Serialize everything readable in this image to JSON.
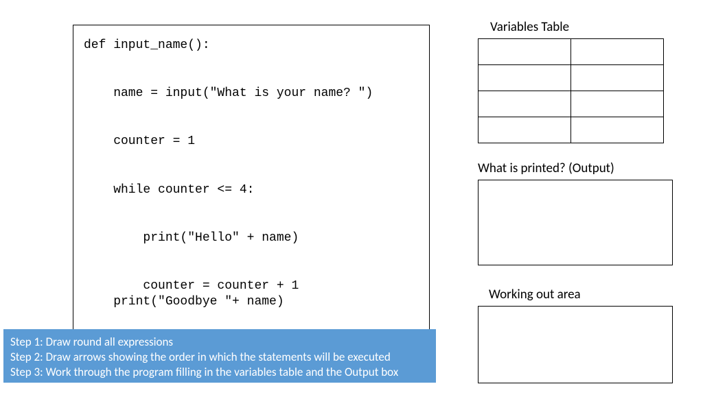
{
  "code": {
    "line1": "def input_name():",
    "line2": "",
    "line3": "    name = input(\"What is your name? \")",
    "line4": "",
    "line5": "    counter = 1",
    "line6": "",
    "line7": "    while counter <= 4:",
    "line8": "",
    "line9": "        print(\"Hello\" + name)",
    "line10": "",
    "line11": "        counter = counter + 1",
    "line12": "    print(\"Goodbye \"+ name)"
  },
  "headings": {
    "variables_table": "Variables Table",
    "output": "What is printed? (Output)",
    "working": "Working out area"
  },
  "steps": {
    "step1": "Step 1: Draw round all expressions",
    "step2": "Step 2: Draw arrows showing the order in which the  statements will be executed",
    "step3": "Step 3: Work through the program filling in the variables table and the Output box"
  },
  "variables_table": {
    "rows": 4,
    "cols": 2
  }
}
